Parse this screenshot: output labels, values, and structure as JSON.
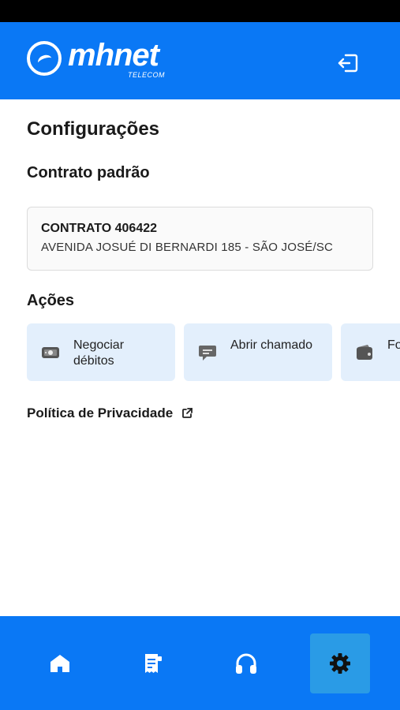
{
  "header": {
    "logo_text": "mhnet",
    "logo_subtext": "TELECOM"
  },
  "page_title": "Configurações",
  "contract_section": {
    "title": "Contrato padrão",
    "contract_number": "CONTRATO 406422",
    "address": "AVENIDA JOSUÉ DI BERNARDI 185 - SÃO JOSÉ/SC"
  },
  "actions_section": {
    "title": "Ações",
    "items": [
      {
        "label": "Negociar débitos",
        "icon": "money-icon"
      },
      {
        "label": "Abrir chamado",
        "icon": "chat-icon"
      },
      {
        "label": "Fo pa",
        "icon": "wallet-icon"
      }
    ]
  },
  "privacy_link": "Política de Privacidade",
  "bottom_nav": {
    "items": [
      {
        "name": "home",
        "icon": "home-icon"
      },
      {
        "name": "invoices",
        "icon": "receipt-icon"
      },
      {
        "name": "support",
        "icon": "headphones-icon"
      },
      {
        "name": "settings",
        "icon": "gear-icon",
        "active": true
      }
    ]
  },
  "colors": {
    "brand_blue": "#0a78f5",
    "active_nav": "#2a9be6",
    "action_card_bg": "#e3effc"
  }
}
